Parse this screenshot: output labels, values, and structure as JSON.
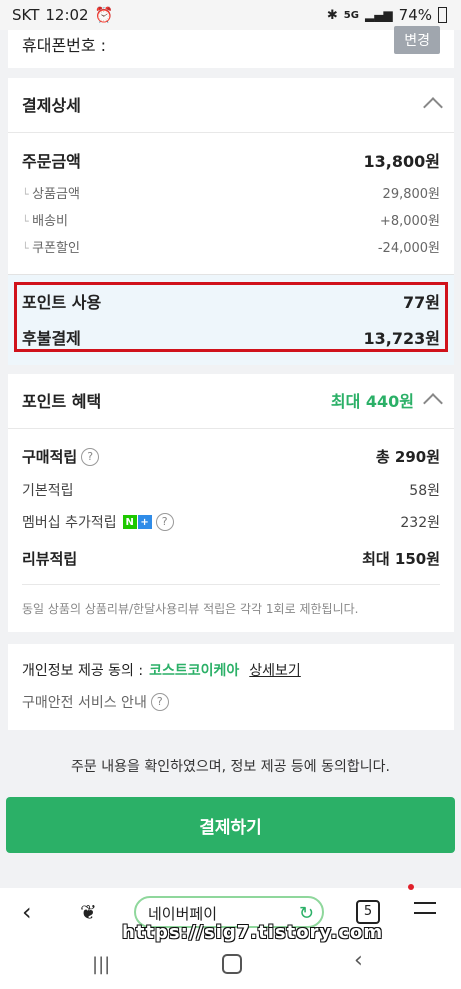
{
  "status": {
    "carrier": "SKT",
    "time": "12:02",
    "battery": "74%"
  },
  "top_partial": {
    "label": "휴대폰번호 :",
    "button": "변경"
  },
  "payment": {
    "title": "결제상세",
    "order_amount_label": "주문금액",
    "order_amount": "13,800원",
    "items": [
      {
        "label": "상품금액",
        "value": "29,800원"
      },
      {
        "label": "배송비",
        "value": "+8,000원"
      },
      {
        "label": "쿠폰할인",
        "value": "-24,000원"
      }
    ],
    "point_use_label": "포인트 사용",
    "point_use": "77원",
    "deferred_label": "후불결제",
    "deferred": "13,723원"
  },
  "benefit": {
    "title": "포인트 혜택",
    "max_label": "최대 440원",
    "purchase_label": "구매적립",
    "purchase_total": "총 290원",
    "basic_label": "기본적립",
    "basic_value": "58원",
    "member_label": "멤버십 추가적립",
    "member_value": "232원",
    "review_label": "리뷰적립",
    "review_value": "최대 150원",
    "notice": "동일 상품의 상품리뷰/한달사용리뷰 적립은 각각 1회로 제한됩니다."
  },
  "consent": {
    "privacy_label": "개인정보 제공 동의 :",
    "privacy_company": "코스트코이케아",
    "privacy_detail": "상세보기",
    "safety_label": "구매안전 서비스 안내"
  },
  "agree_text": "주문 내용을 확인하였으며, 정보 제공 등에 동의합니다.",
  "pay_button": "결제하기",
  "browser": {
    "address": "네이버페이",
    "tabs": "5",
    "watermark": "https://sig7.tistory.com"
  },
  "colors": {
    "green": "#2bb067",
    "highlight_border": "#d0121b",
    "highlight_bg": "#eef6fb"
  }
}
